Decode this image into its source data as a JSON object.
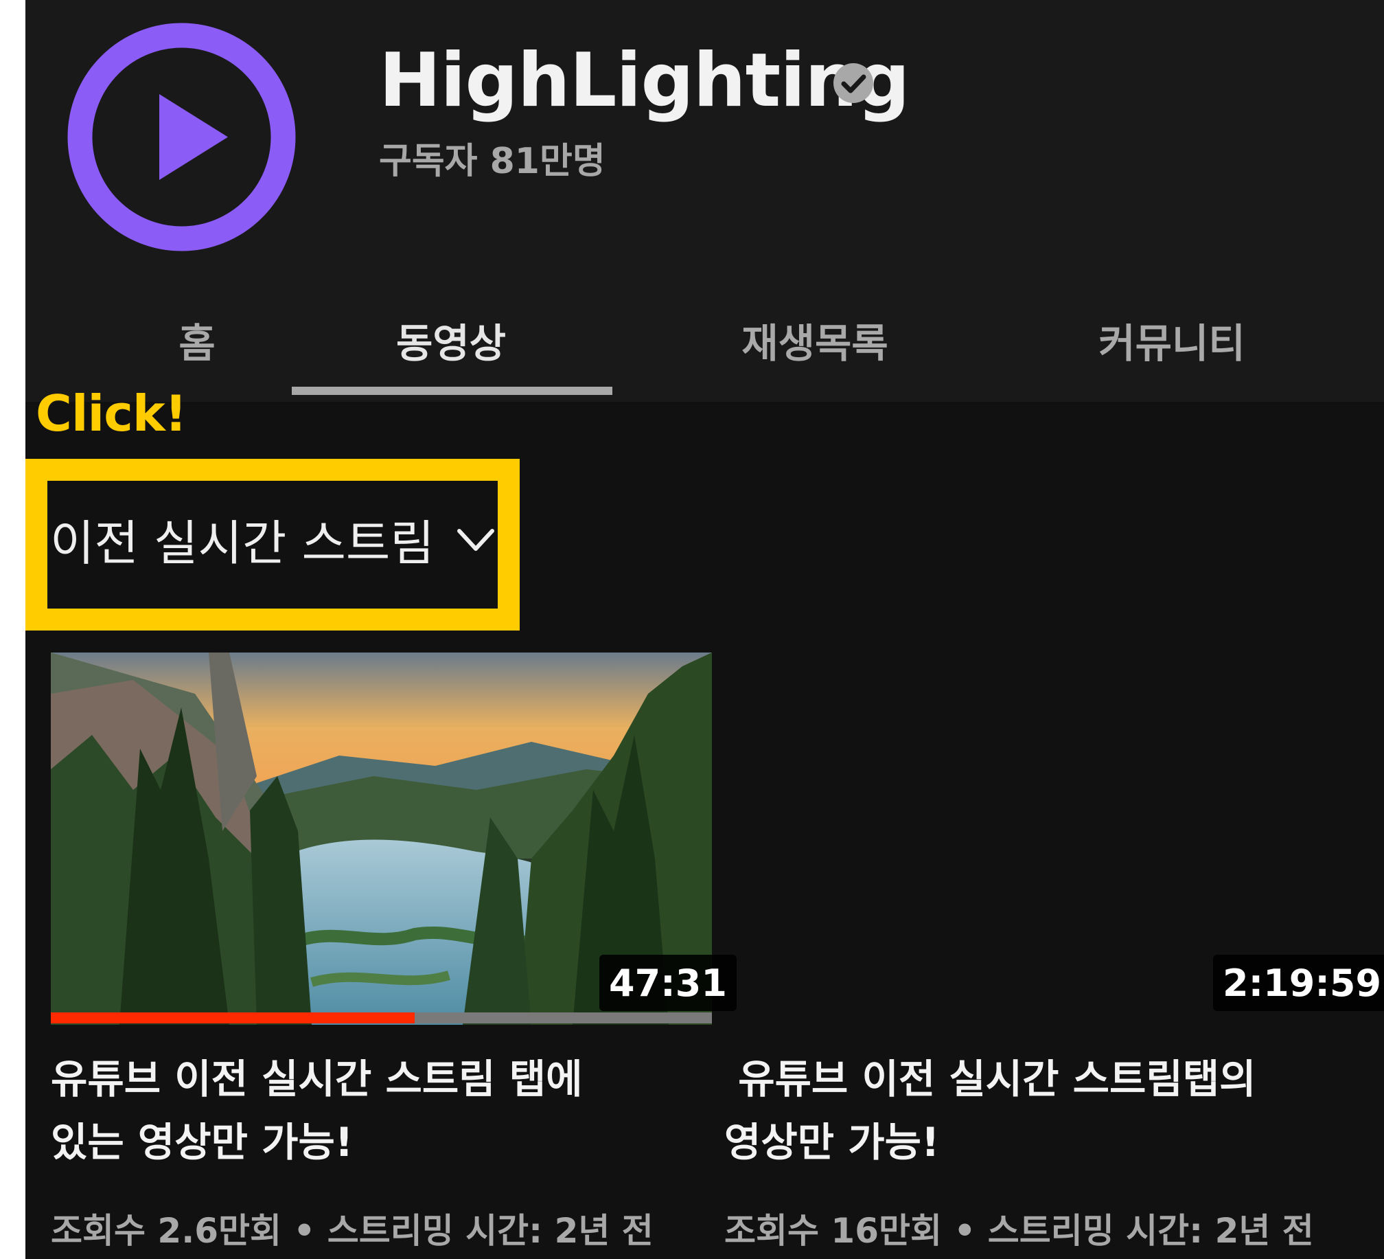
{
  "channel": {
    "name": "HighLighting",
    "subscribers": "구독자 81만명",
    "brand_color": "#8b5cf6"
  },
  "tabs": [
    {
      "label": "홈",
      "active": false
    },
    {
      "label": "동영상",
      "active": true
    },
    {
      "label": "재생목록",
      "active": false
    },
    {
      "label": "커뮤니티",
      "active": false
    }
  ],
  "annotation": {
    "label": "Click!",
    "color": "#ffcc00"
  },
  "filter": {
    "label": "이전 실시간 스트림",
    "icon": "chevron-down-icon"
  },
  "videos": [
    {
      "title": "유튜브 이전 실시간 스트림 탭에\n있는 영상만 가능!",
      "duration": "47:31",
      "progress": 0.55,
      "meta": "조회수 2.6만회 • 스트리밍 시간: 2년 전"
    },
    {
      "title": " 유튜브 이전 실시간 스트림탭의\n영상만 가능!",
      "duration": "2:19:59",
      "meta": "조회수 16만회 • 스트리밍 시간: 2년 전"
    }
  ]
}
